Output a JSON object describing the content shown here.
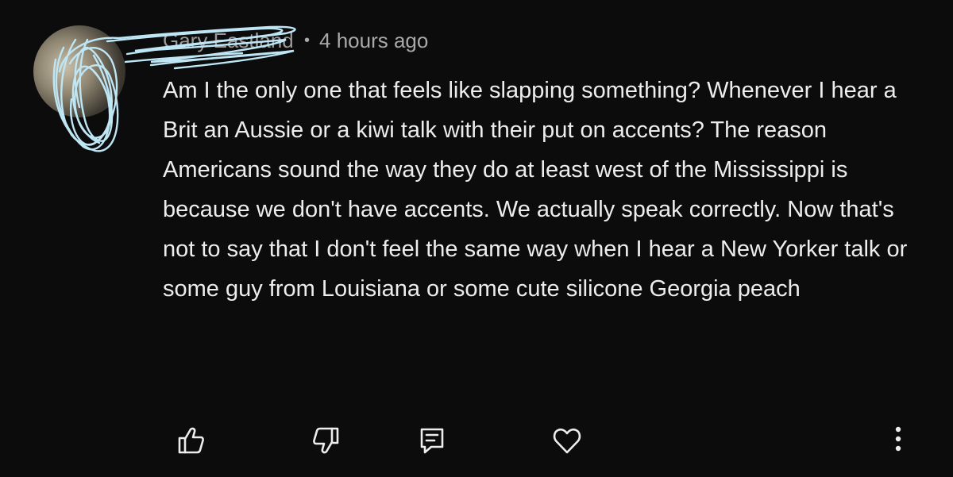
{
  "comment": {
    "author": "Gary Eastland",
    "separator": "•",
    "timestamp": "4 hours ago",
    "text": "Am I the only one that feels like slapping something? Whenever I hear a Brit an Aussie or a kiwi talk with their put on accents? The reason Americans sound the way they do at least west of the Mississippi is because we don't have accents. We actually speak correctly. Now that's not to say that I don't feel the same way when I hear a New Yorker talk or some guy from Louisiana or some cute silicone Georgia peach"
  },
  "actions": [
    {
      "icon": "thumbs-up-icon"
    },
    {
      "icon": "thumbs-down-icon"
    },
    {
      "icon": "reply-icon"
    },
    {
      "icon": "heart-icon"
    },
    {
      "icon": "more-vertical-icon"
    }
  ],
  "colors": {
    "background": "#0c0c0c",
    "text": "#ededed",
    "meta": "#a9a9a9",
    "scribble": "#bfe6f4"
  }
}
